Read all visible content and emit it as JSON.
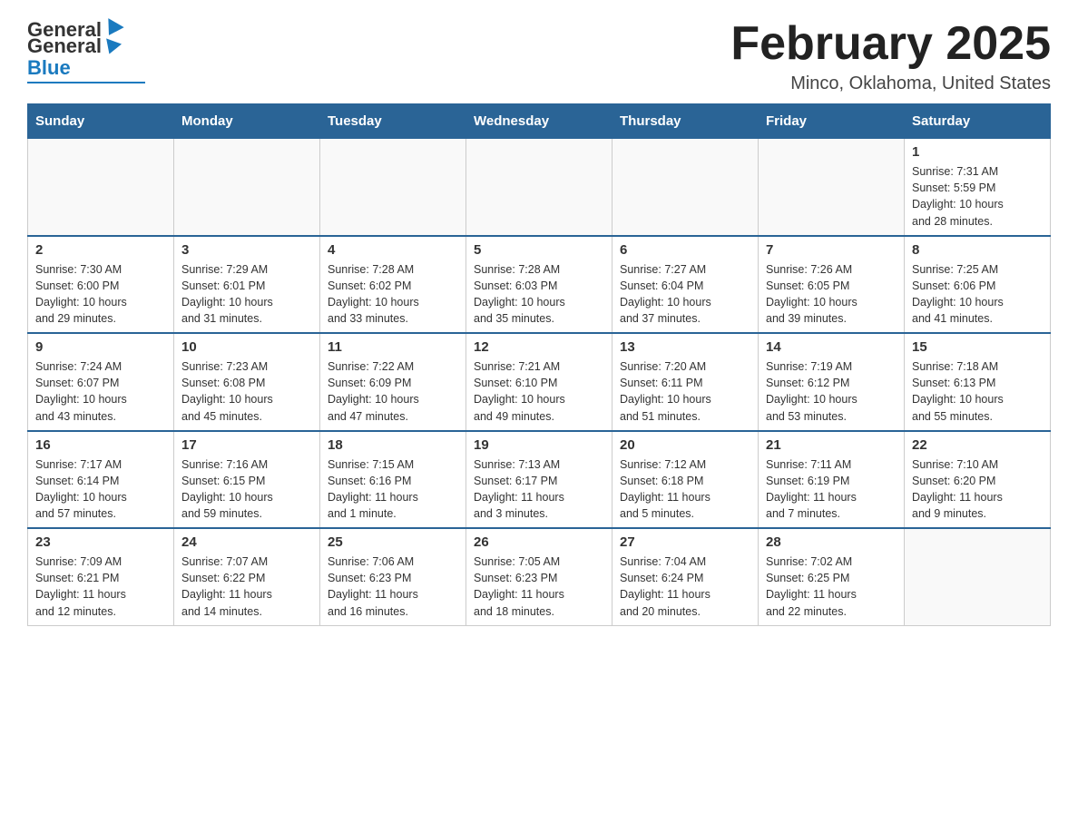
{
  "logo": {
    "general": "General",
    "blue": "Blue"
  },
  "title": "February 2025",
  "location": "Minco, Oklahoma, United States",
  "days_of_week": [
    "Sunday",
    "Monday",
    "Tuesday",
    "Wednesday",
    "Thursday",
    "Friday",
    "Saturday"
  ],
  "weeks": [
    [
      {
        "day": "",
        "info": ""
      },
      {
        "day": "",
        "info": ""
      },
      {
        "day": "",
        "info": ""
      },
      {
        "day": "",
        "info": ""
      },
      {
        "day": "",
        "info": ""
      },
      {
        "day": "",
        "info": ""
      },
      {
        "day": "1",
        "info": "Sunrise: 7:31 AM\nSunset: 5:59 PM\nDaylight: 10 hours\nand 28 minutes."
      }
    ],
    [
      {
        "day": "2",
        "info": "Sunrise: 7:30 AM\nSunset: 6:00 PM\nDaylight: 10 hours\nand 29 minutes."
      },
      {
        "day": "3",
        "info": "Sunrise: 7:29 AM\nSunset: 6:01 PM\nDaylight: 10 hours\nand 31 minutes."
      },
      {
        "day": "4",
        "info": "Sunrise: 7:28 AM\nSunset: 6:02 PM\nDaylight: 10 hours\nand 33 minutes."
      },
      {
        "day": "5",
        "info": "Sunrise: 7:28 AM\nSunset: 6:03 PM\nDaylight: 10 hours\nand 35 minutes."
      },
      {
        "day": "6",
        "info": "Sunrise: 7:27 AM\nSunset: 6:04 PM\nDaylight: 10 hours\nand 37 minutes."
      },
      {
        "day": "7",
        "info": "Sunrise: 7:26 AM\nSunset: 6:05 PM\nDaylight: 10 hours\nand 39 minutes."
      },
      {
        "day": "8",
        "info": "Sunrise: 7:25 AM\nSunset: 6:06 PM\nDaylight: 10 hours\nand 41 minutes."
      }
    ],
    [
      {
        "day": "9",
        "info": "Sunrise: 7:24 AM\nSunset: 6:07 PM\nDaylight: 10 hours\nand 43 minutes."
      },
      {
        "day": "10",
        "info": "Sunrise: 7:23 AM\nSunset: 6:08 PM\nDaylight: 10 hours\nand 45 minutes."
      },
      {
        "day": "11",
        "info": "Sunrise: 7:22 AM\nSunset: 6:09 PM\nDaylight: 10 hours\nand 47 minutes."
      },
      {
        "day": "12",
        "info": "Sunrise: 7:21 AM\nSunset: 6:10 PM\nDaylight: 10 hours\nand 49 minutes."
      },
      {
        "day": "13",
        "info": "Sunrise: 7:20 AM\nSunset: 6:11 PM\nDaylight: 10 hours\nand 51 minutes."
      },
      {
        "day": "14",
        "info": "Sunrise: 7:19 AM\nSunset: 6:12 PM\nDaylight: 10 hours\nand 53 minutes."
      },
      {
        "day": "15",
        "info": "Sunrise: 7:18 AM\nSunset: 6:13 PM\nDaylight: 10 hours\nand 55 minutes."
      }
    ],
    [
      {
        "day": "16",
        "info": "Sunrise: 7:17 AM\nSunset: 6:14 PM\nDaylight: 10 hours\nand 57 minutes."
      },
      {
        "day": "17",
        "info": "Sunrise: 7:16 AM\nSunset: 6:15 PM\nDaylight: 10 hours\nand 59 minutes."
      },
      {
        "day": "18",
        "info": "Sunrise: 7:15 AM\nSunset: 6:16 PM\nDaylight: 11 hours\nand 1 minute."
      },
      {
        "day": "19",
        "info": "Sunrise: 7:13 AM\nSunset: 6:17 PM\nDaylight: 11 hours\nand 3 minutes."
      },
      {
        "day": "20",
        "info": "Sunrise: 7:12 AM\nSunset: 6:18 PM\nDaylight: 11 hours\nand 5 minutes."
      },
      {
        "day": "21",
        "info": "Sunrise: 7:11 AM\nSunset: 6:19 PM\nDaylight: 11 hours\nand 7 minutes."
      },
      {
        "day": "22",
        "info": "Sunrise: 7:10 AM\nSunset: 6:20 PM\nDaylight: 11 hours\nand 9 minutes."
      }
    ],
    [
      {
        "day": "23",
        "info": "Sunrise: 7:09 AM\nSunset: 6:21 PM\nDaylight: 11 hours\nand 12 minutes."
      },
      {
        "day": "24",
        "info": "Sunrise: 7:07 AM\nSunset: 6:22 PM\nDaylight: 11 hours\nand 14 minutes."
      },
      {
        "day": "25",
        "info": "Sunrise: 7:06 AM\nSunset: 6:23 PM\nDaylight: 11 hours\nand 16 minutes."
      },
      {
        "day": "26",
        "info": "Sunrise: 7:05 AM\nSunset: 6:23 PM\nDaylight: 11 hours\nand 18 minutes."
      },
      {
        "day": "27",
        "info": "Sunrise: 7:04 AM\nSunset: 6:24 PM\nDaylight: 11 hours\nand 20 minutes."
      },
      {
        "day": "28",
        "info": "Sunrise: 7:02 AM\nSunset: 6:25 PM\nDaylight: 11 hours\nand 22 minutes."
      },
      {
        "day": "",
        "info": ""
      }
    ]
  ]
}
